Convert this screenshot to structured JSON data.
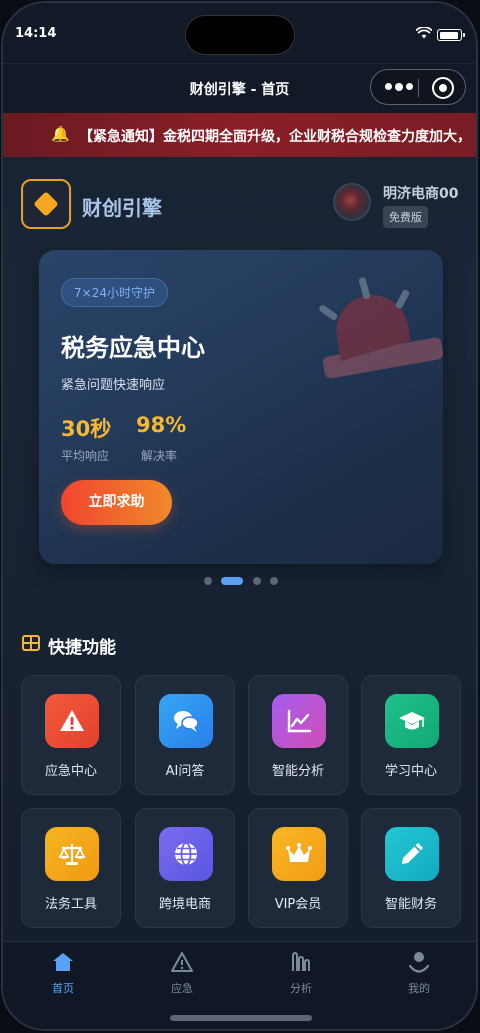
{
  "status_bar": {
    "time": "14:14"
  },
  "nav": {
    "title": "财创引擎 - 首页"
  },
  "notice": {
    "text": "【紧急通知】金税四期全面升级，企业财税合规检查力度加大，"
  },
  "brand": {
    "name": "财创引擎"
  },
  "user": {
    "name": "明济电商00",
    "plan": "免费版"
  },
  "hero": {
    "badge": "7×24小时守护",
    "title": "税务应急中心",
    "subtitle": "紧急问题快速响应",
    "stats": [
      {
        "value": "30秒",
        "label": "平均响应"
      },
      {
        "value": "98%",
        "label": "解决率"
      }
    ],
    "cta": "立即求助",
    "carousel_active_index": 1,
    "carousel_count": 4
  },
  "quick": {
    "title": "快捷功能",
    "items": [
      {
        "label": "应急中心",
        "icon": "warning-icon"
      },
      {
        "label": "AI问答",
        "icon": "chat-icon"
      },
      {
        "label": "智能分析",
        "icon": "line-chart-icon"
      },
      {
        "label": "学习中心",
        "icon": "graduation-cap-icon"
      },
      {
        "label": "法务工具",
        "icon": "scale-icon"
      },
      {
        "label": "跨境电商",
        "icon": "globe-icon"
      },
      {
        "label": "VIP会员",
        "icon": "crown-icon"
      },
      {
        "label": "智能财务",
        "icon": "pen-icon"
      }
    ]
  },
  "tabs": [
    {
      "label": "首页",
      "icon": "home-icon",
      "active": true
    },
    {
      "label": "应急",
      "icon": "warning-icon",
      "active": false
    },
    {
      "label": "分析",
      "icon": "bar-chart-icon",
      "active": false
    },
    {
      "label": "我的",
      "icon": "user-icon",
      "active": false
    }
  ],
  "colors": {
    "accent": "#5aa0f5",
    "highlight": "#f5b833",
    "notice_bg": "#8a1f28",
    "cta_start": "#f0452f",
    "cta_end": "#f08a2a"
  }
}
